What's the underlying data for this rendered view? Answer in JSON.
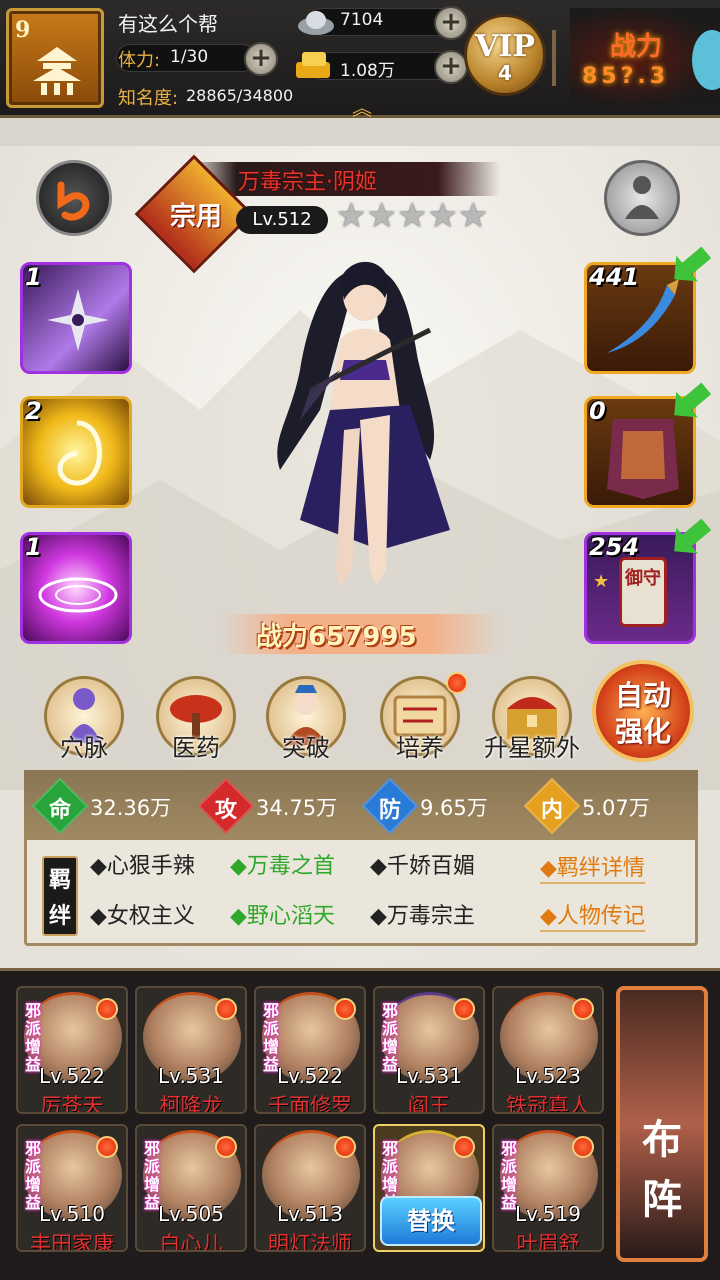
{
  "top": {
    "level": "9",
    "guild_name": "有这么个帮",
    "stamina_label": "体力:",
    "stamina_value": "1/30",
    "fame_label": "知名度:",
    "fame_value": "28865/34800",
    "silver": "7104",
    "gold": "1.08万",
    "vip_text": "VIP",
    "vip_level": "4",
    "power_label": "战力",
    "power_value": "85?.3"
  },
  "hero": {
    "title_badge": "宗用",
    "name": "万毒宗主·阴姬",
    "level": "Lv.512",
    "stars": 5,
    "power_label": "战力",
    "power_value": "657995"
  },
  "skills": [
    "1",
    "2",
    "1"
  ],
  "equipment": [
    "441",
    "0",
    "254"
  ],
  "equipment_charm_text": "御守",
  "actions": [
    "穴脉",
    "医药",
    "突破",
    "培养",
    "升星额外"
  ],
  "auto_button": [
    "自动",
    "强化"
  ],
  "stats": [
    {
      "icon": "命",
      "value": "32.36万",
      "color": "#27a53a"
    },
    {
      "icon": "攻",
      "value": "34.75万",
      "color": "#d42a2a"
    },
    {
      "icon": "防",
      "value": "9.65万",
      "color": "#2a7ad8"
    },
    {
      "icon": "内",
      "value": "5.07万",
      "color": "#e6a020"
    }
  ],
  "bond_label": "羁绊",
  "bonds_row1": [
    {
      "text": "心狠手辣",
      "active": false
    },
    {
      "text": "万毒之首",
      "active": true
    },
    {
      "text": "千娇百媚",
      "active": false
    }
  ],
  "bonds_row2": [
    {
      "text": "女权主义",
      "active": false
    },
    {
      "text": "野心滔天",
      "active": true
    },
    {
      "text": "万毒宗主",
      "active": false
    }
  ],
  "links": [
    "羁绊详情",
    "人物传记"
  ],
  "roster_tag": "邪派增益",
  "roster": [
    {
      "lv": "Lv.522",
      "name": "厉苍天",
      "tag": true
    },
    {
      "lv": "Lv.531",
      "name": "柯降龙",
      "tag": false
    },
    {
      "lv": "Lv.522",
      "name": "千面修罗",
      "tag": true
    },
    {
      "lv": "Lv.531",
      "name": "阎王",
      "tag": true
    },
    {
      "lv": "Lv.523",
      "name": "铁冠真人",
      "tag": false
    },
    {
      "lv": "Lv.510",
      "name": "丰田家康",
      "tag": true
    },
    {
      "lv": "Lv.505",
      "name": "白心儿",
      "tag": true
    },
    {
      "lv": "Lv.513",
      "name": "明灯法师",
      "tag": false
    },
    {
      "lv": "",
      "name": "",
      "tag": true
    },
    {
      "lv": "Lv.519",
      "name": "叶眉舒",
      "tag": true
    }
  ],
  "swap_button": "替换",
  "formation_button": [
    "布",
    "阵"
  ]
}
